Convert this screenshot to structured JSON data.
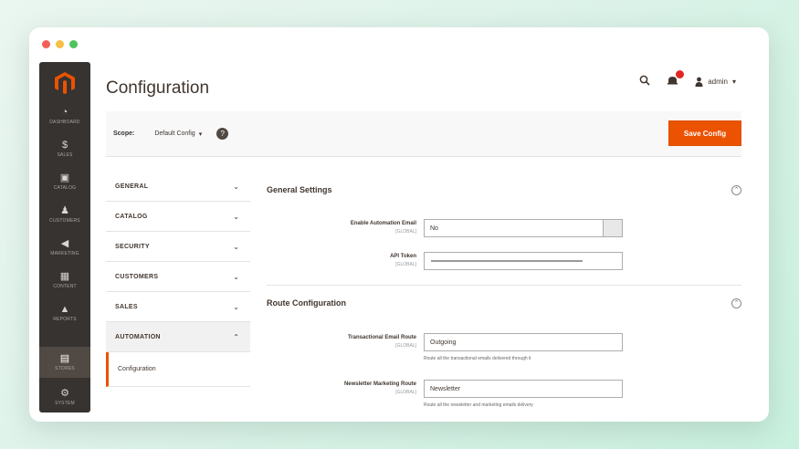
{
  "window": {
    "traffic_lights": {
      "close": "#f26157",
      "minimize": "#f7c044",
      "zoom": "#4fc45a"
    }
  },
  "sidebar": {
    "logo_icon": "magento-logo-icon",
    "items": [
      {
        "icon": "dashboard-icon",
        "glyph": "◔",
        "caption": "DASHBOARD"
      },
      {
        "icon": "sales-icon",
        "glyph": "$",
        "caption": "SALES"
      },
      {
        "icon": "catalog-icon",
        "glyph": "▣",
        "caption": "CATALOG"
      },
      {
        "icon": "customers-icon",
        "glyph": "♟",
        "caption": "CUSTOMERS"
      },
      {
        "icon": "marketing-icon",
        "glyph": "◀",
        "caption": "MARKETING"
      },
      {
        "icon": "content-icon",
        "glyph": "▦",
        "caption": "CONTENT"
      },
      {
        "icon": "reports-icon",
        "glyph": "▲",
        "caption": "REPORTS"
      },
      {
        "icon": "stores-icon",
        "glyph": "▤",
        "caption": "STORES",
        "active": true
      },
      {
        "icon": "system-icon",
        "glyph": "⚙",
        "caption": "SYSTEM"
      }
    ]
  },
  "header": {
    "title": "Configuration",
    "user_name": "admin",
    "search_icon": "search-icon",
    "notifications_icon": "bell-icon"
  },
  "scope": {
    "label": "Scope:",
    "selected": "Default Config",
    "help_glyph": "?",
    "save_label": "Save Config"
  },
  "tabs": {
    "items": [
      {
        "label": "GENERAL"
      },
      {
        "label": "CATALOG"
      },
      {
        "label": "SECURITY"
      },
      {
        "label": "CUSTOMERS"
      },
      {
        "label": "SALES"
      },
      {
        "label": "AUTOMATION",
        "open": true
      }
    ],
    "sub_item": "Configuration"
  },
  "sections": [
    {
      "title": "General Settings",
      "fields": [
        {
          "label": "Enable Automation Email",
          "scope": "[GLOBAL]",
          "value": "No"
        },
        {
          "label": "API Token",
          "scope": "[GLOBAL]",
          "value": ""
        }
      ]
    },
    {
      "title": "Route Configuration",
      "fields": [
        {
          "label": "Transactional Email Route",
          "scope": "[GLOBAL]",
          "value": "Outgoing",
          "note": "Route all the transactional emails delivered through it"
        },
        {
          "label": "Newsletter Marketing Route",
          "scope": "[GLOBAL]",
          "value": "Newsletter",
          "note": "Route all the newsletter and marketing emails delivery"
        }
      ]
    }
  ],
  "colors": {
    "accent": "#eb5202",
    "sidebar_bg": "#373330",
    "notification": "#e22626"
  }
}
